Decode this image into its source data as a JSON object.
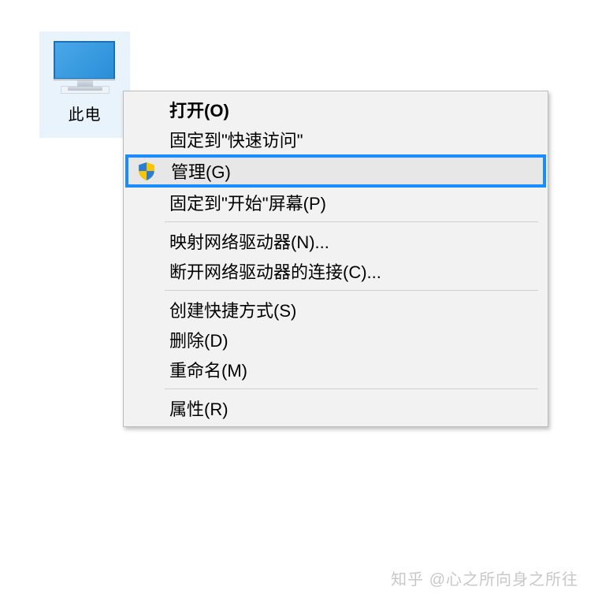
{
  "desktop": {
    "icon_label": "此电"
  },
  "context_menu": {
    "items": {
      "open": "打开(O)",
      "pin_quickaccess": "固定到\"快速访问\"",
      "manage": "管理(G)",
      "pin_start": "固定到\"开始\"屏幕(P)",
      "map_network": "映射网络驱动器(N)...",
      "disconnect_network": "断开网络驱动器的连接(C)...",
      "create_shortcut": "创建快捷方式(S)",
      "delete": "删除(D)",
      "rename": "重命名(M)",
      "properties": "属性(R)"
    }
  },
  "watermark": "知乎 @心之所向身之所往"
}
